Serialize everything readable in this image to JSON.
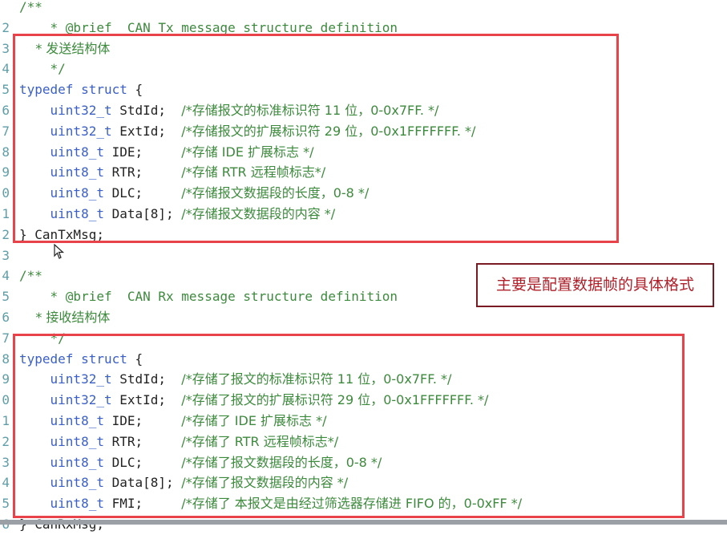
{
  "lines": [
    {
      "ln": "",
      "segments": [
        {
          "text": "/**",
          "cls": "cmt"
        }
      ]
    },
    {
      "ln": "2",
      "segments": [
        {
          "text": "    * @brief  CAN Tx message structure definition",
          "cls": "cmt"
        }
      ]
    },
    {
      "ln": "3",
      "segments": [
        {
          "text": "    * 发送结构体",
          "cls": "cmt"
        }
      ]
    },
    {
      "ln": "4",
      "segments": [
        {
          "text": "    */",
          "cls": "cmt"
        }
      ]
    },
    {
      "ln": "5",
      "segments": [
        {
          "text": "typedef",
          "cls": "kw"
        },
        {
          "text": " ",
          "cls": "tx"
        },
        {
          "text": "struct",
          "cls": "kw"
        },
        {
          "text": " {",
          "cls": "tx"
        }
      ]
    },
    {
      "ln": "6",
      "segments": [
        {
          "text": "    uint32_t",
          "cls": "ty"
        },
        {
          "text": " StdId;  ",
          "cls": "tx"
        },
        {
          "text": "/*存储报文的标准标识符 11 位，0-0x7FF. */",
          "cls": "cmt"
        }
      ]
    },
    {
      "ln": "7",
      "segments": [
        {
          "text": "    uint32_t",
          "cls": "ty"
        },
        {
          "text": " ExtId;  ",
          "cls": "tx"
        },
        {
          "text": "/*存储报文的扩展标识符 29 位，0-0x1FFFFFFF. */",
          "cls": "cmt"
        }
      ]
    },
    {
      "ln": "8",
      "segments": [
        {
          "text": "    uint8_t",
          "cls": "ty"
        },
        {
          "text": " IDE;     ",
          "cls": "tx"
        },
        {
          "text": "/*存储 IDE 扩展标志 */",
          "cls": "cmt"
        }
      ]
    },
    {
      "ln": "9",
      "segments": [
        {
          "text": "    uint8_t",
          "cls": "ty"
        },
        {
          "text": " RTR;     ",
          "cls": "tx"
        },
        {
          "text": "/*存储 RTR 远程帧标志*/",
          "cls": "cmt"
        }
      ]
    },
    {
      "ln": "0",
      "segments": [
        {
          "text": "    uint8_t",
          "cls": "ty"
        },
        {
          "text": " DLC;     ",
          "cls": "tx"
        },
        {
          "text": "/*存储报文数据段的长度，0-8 */",
          "cls": "cmt"
        }
      ]
    },
    {
      "ln": "1",
      "segments": [
        {
          "text": "    uint8_t",
          "cls": "ty"
        },
        {
          "text": " Data[8]; ",
          "cls": "tx"
        },
        {
          "text": "/*存储报文数据段的内容 */",
          "cls": "cmt"
        }
      ]
    },
    {
      "ln": "2",
      "segments": [
        {
          "text": "} CanTxMsg;",
          "cls": "tx"
        }
      ]
    },
    {
      "ln": "3",
      "segments": []
    },
    {
      "ln": "4",
      "segments": [
        {
          "text": "/**",
          "cls": "cmt"
        }
      ]
    },
    {
      "ln": "5",
      "segments": [
        {
          "text": "    * @brief  CAN Rx message structure definition",
          "cls": "cmt"
        }
      ]
    },
    {
      "ln": "6",
      "segments": [
        {
          "text": "    * 接收结构体",
          "cls": "cmt"
        }
      ]
    },
    {
      "ln": "7",
      "segments": [
        {
          "text": "    */",
          "cls": "cmt"
        }
      ]
    },
    {
      "ln": "8",
      "segments": [
        {
          "text": "typedef",
          "cls": "kw"
        },
        {
          "text": " ",
          "cls": "tx"
        },
        {
          "text": "struct",
          "cls": "kw"
        },
        {
          "text": " {",
          "cls": "tx"
        }
      ]
    },
    {
      "ln": "9",
      "segments": [
        {
          "text": "    uint32_t",
          "cls": "ty"
        },
        {
          "text": " StdId;  ",
          "cls": "tx"
        },
        {
          "text": "/*存储了报文的标准标识符 11 位，0-0x7FF. */",
          "cls": "cmt"
        }
      ]
    },
    {
      "ln": "0",
      "segments": [
        {
          "text": "    uint32_t",
          "cls": "ty"
        },
        {
          "text": " ExtId;  ",
          "cls": "tx"
        },
        {
          "text": "/*存储了报文的扩展标识符 29 位，0-0x1FFFFFFF. */",
          "cls": "cmt"
        }
      ]
    },
    {
      "ln": "1",
      "segments": [
        {
          "text": "    uint8_t",
          "cls": "ty"
        },
        {
          "text": " IDE;     ",
          "cls": "tx"
        },
        {
          "text": "/*存储了 IDE 扩展标志 */",
          "cls": "cmt"
        }
      ]
    },
    {
      "ln": "2",
      "segments": [
        {
          "text": "    uint8_t",
          "cls": "ty"
        },
        {
          "text": " RTR;     ",
          "cls": "tx"
        },
        {
          "text": "/*存储了 RTR 远程帧标志*/",
          "cls": "cmt"
        }
      ]
    },
    {
      "ln": "3",
      "segments": [
        {
          "text": "    uint8_t",
          "cls": "ty"
        },
        {
          "text": " DLC;     ",
          "cls": "tx"
        },
        {
          "text": "/*存储了报文数据段的长度，0-8 */",
          "cls": "cmt"
        }
      ]
    },
    {
      "ln": "4",
      "segments": [
        {
          "text": "    uint8_t",
          "cls": "ty"
        },
        {
          "text": " Data[8]; ",
          "cls": "tx"
        },
        {
          "text": "/*存储了报文数据段的内容 */",
          "cls": "cmt"
        }
      ]
    },
    {
      "ln": "5",
      "segments": [
        {
          "text": "    uint8_t",
          "cls": "ty"
        },
        {
          "text": " FMI;     ",
          "cls": "tx"
        },
        {
          "text": "/*存储了 本报文是由经过筛选器存储进 FIFO 的，0-0xFF */",
          "cls": "cmt"
        }
      ]
    },
    {
      "ln": "6",
      "segments": [
        {
          "text": "} CanRxMsg;",
          "cls": "tx"
        }
      ]
    }
  ],
  "callout": {
    "text": "主要是配置数据帧的具体格式"
  },
  "colors": {
    "highlight_box": "#e8424a",
    "callout_border": "#7a1a22",
    "callout_text": "#b0202a",
    "comment": "#3c8a3c",
    "keyword": "#3a5fc8"
  },
  "icons": {
    "cursor": "mouse-pointer-icon"
  }
}
